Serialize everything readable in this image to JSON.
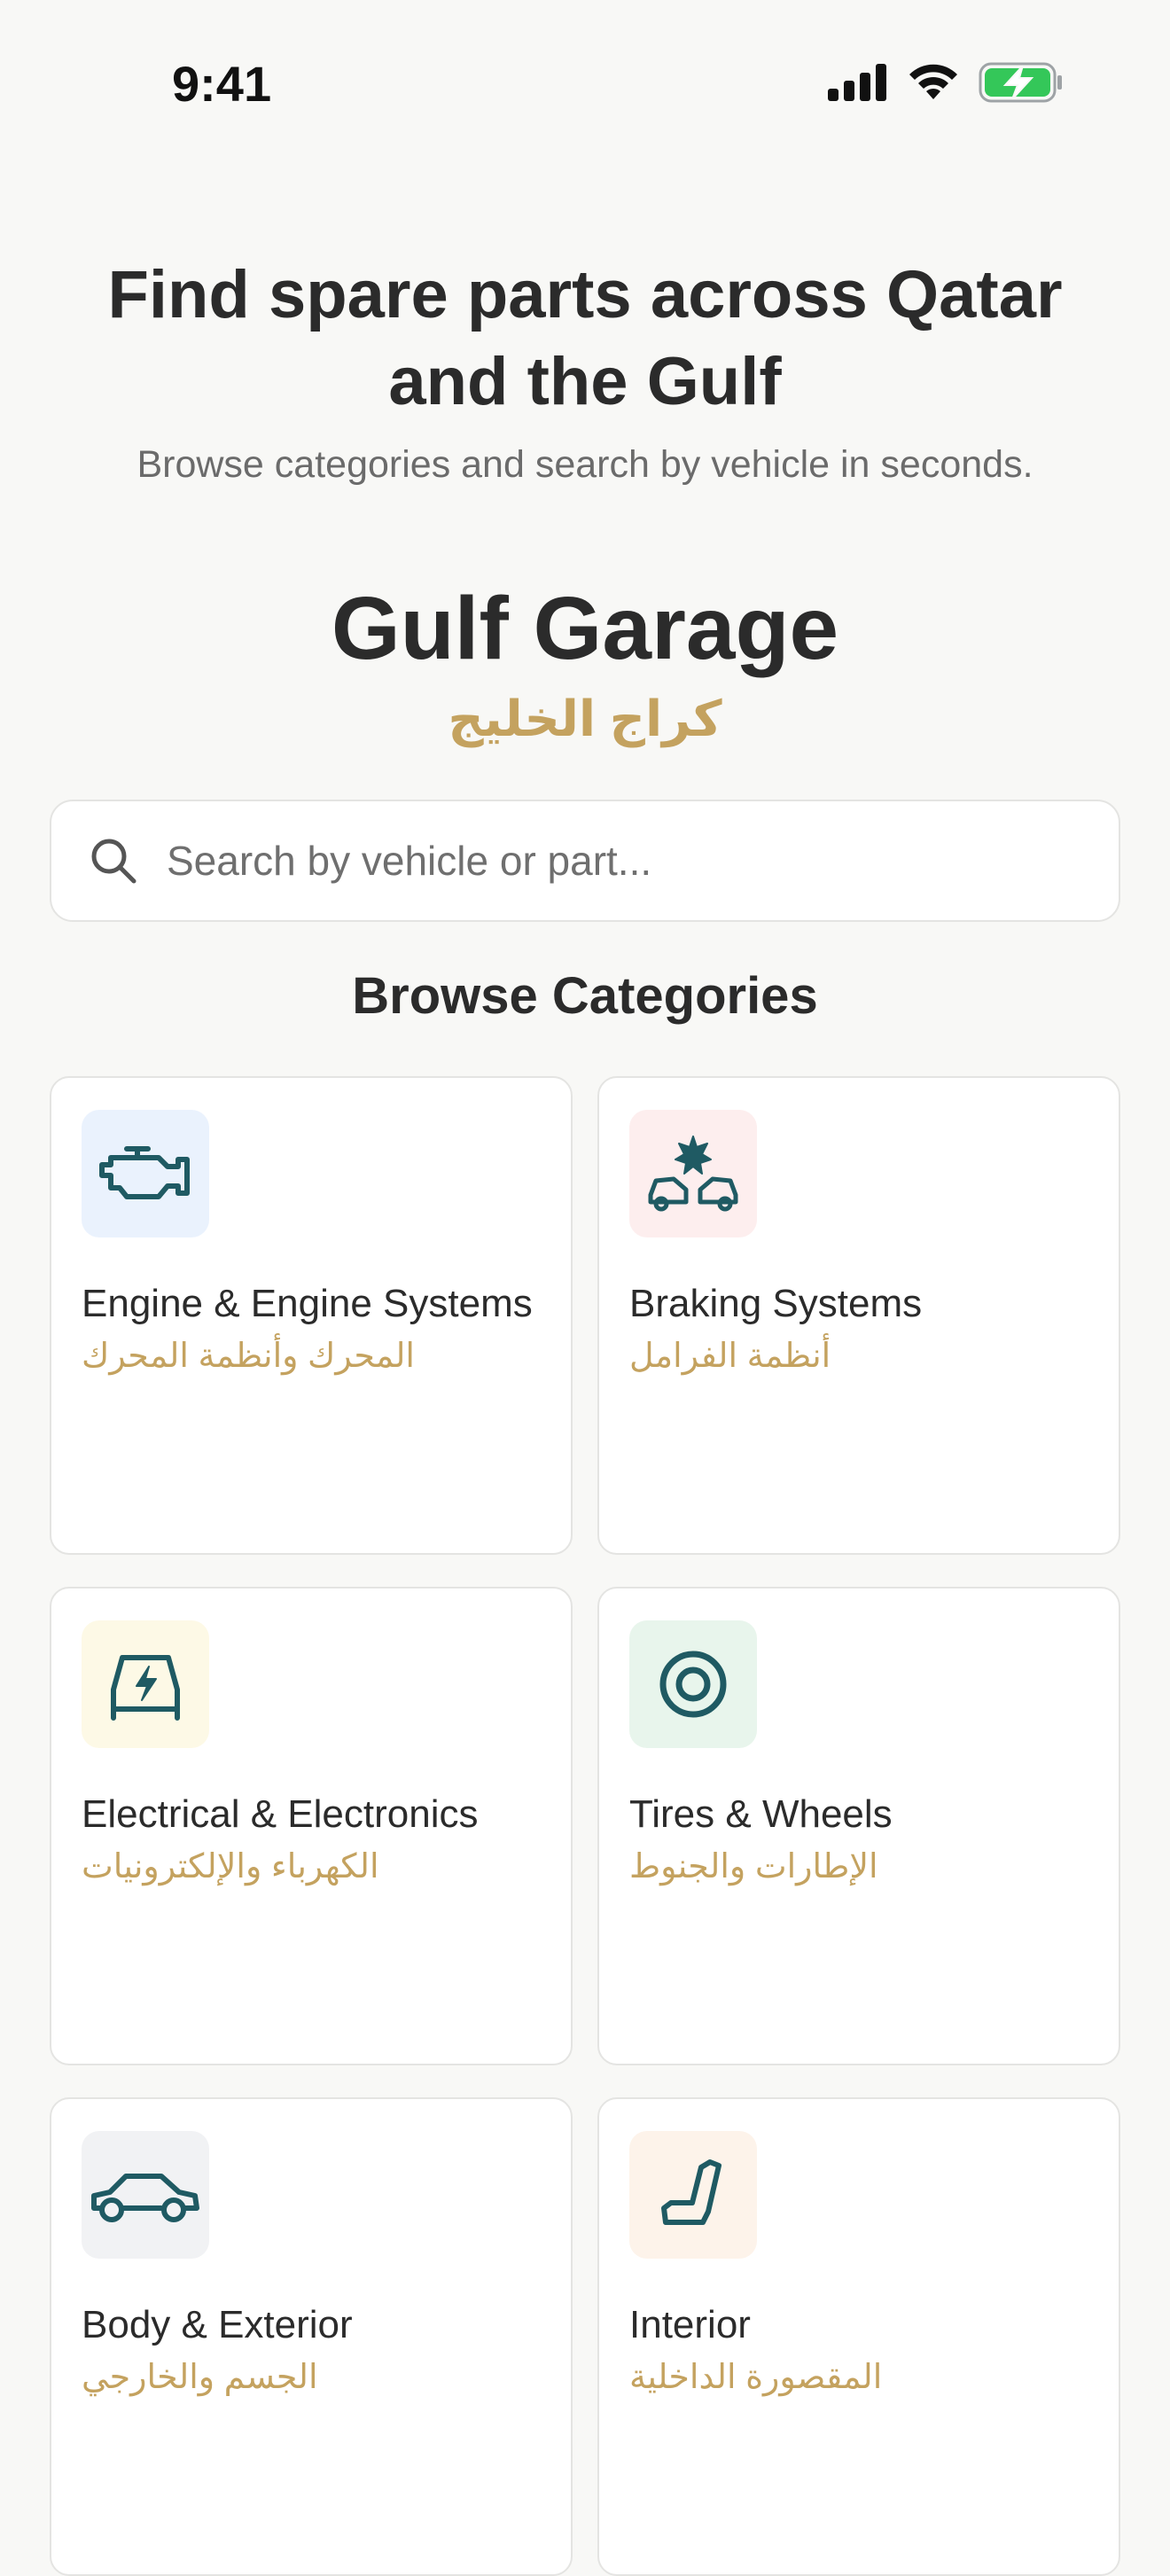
{
  "status_bar": {
    "time": "9:41",
    "signal_icon": "cellular-signal-icon",
    "wifi_icon": "wifi-icon",
    "battery_icon": "battery-charging-icon",
    "battery_color": "#34c759"
  },
  "hero": {
    "title": "Find spare parts across Qatar and the Gulf",
    "subtitle": "Browse categories and search by vehicle in seconds."
  },
  "brand": {
    "name": "Gulf Garage",
    "name_ar": "كراج الخليج",
    "accent_color": "#c4a25f",
    "icon_color": "#1f5a63"
  },
  "search": {
    "placeholder": "Search by vehicle or part...",
    "value": ""
  },
  "categories_section": {
    "title": "Browse Categories",
    "items": [
      {
        "title": "Engine & Engine Systems",
        "subtitle": "المحرك وأنظمة المحرك",
        "icon": "engine-icon",
        "icon_bg": "#eaf2fd"
      },
      {
        "title": "Braking Systems",
        "subtitle": "أنظمة الفرامل",
        "icon": "car-crash-icon",
        "icon_bg": "#fdeeee"
      },
      {
        "title": "Electrical & Electronics",
        "subtitle": "الكهرباء والإلكترونيات",
        "icon": "electric-car-icon",
        "icon_bg": "#fdf9e6"
      },
      {
        "title": "Tires & Wheels",
        "subtitle": "الإطارات والجنوط",
        "icon": "tire-icon",
        "icon_bg": "#e8f5ec"
      },
      {
        "title": "Body & Exterior",
        "subtitle": "الجسم والخارجي",
        "icon": "car-body-icon",
        "icon_bg": "#f1f2f4"
      },
      {
        "title": "Interior",
        "subtitle": "المقصورة الداخلية",
        "icon": "car-seat-icon",
        "icon_bg": "#fdf3ea"
      }
    ]
  }
}
